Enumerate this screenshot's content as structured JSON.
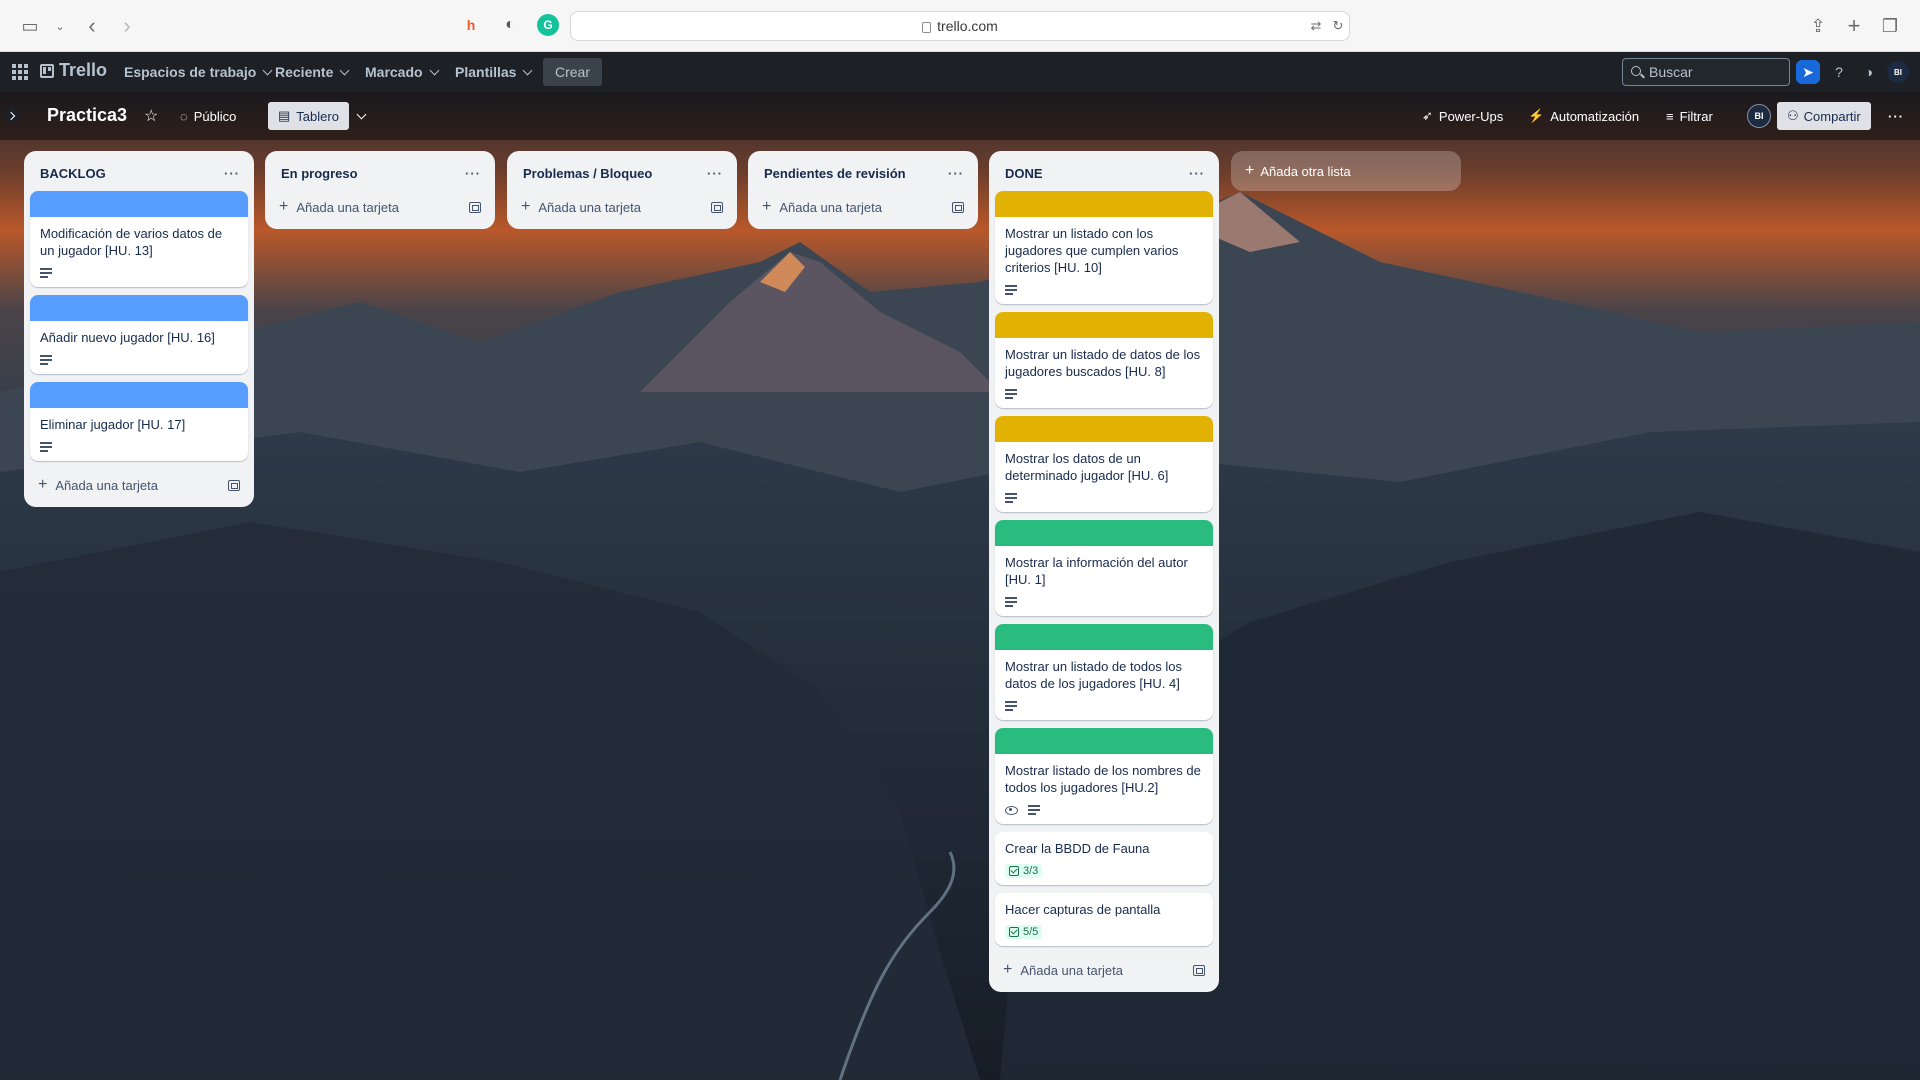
{
  "browser": {
    "url": "trello.com"
  },
  "topnav": {
    "logo": "Trello",
    "menus": [
      "Espacios de trabajo",
      "Reciente",
      "Marcado",
      "Plantillas"
    ],
    "create": "Crear",
    "search_placeholder": "Buscar",
    "avatar": "BI"
  },
  "board": {
    "title": "Practica3",
    "visibility": "Público",
    "view": "Tablero",
    "powerups": "Power-Ups",
    "automation": "Automatización",
    "filter": "Filtrar",
    "share": "Compartir",
    "avatar": "BI"
  },
  "add_card_label": "Añada una tarjeta",
  "add_list_label": "Añada otra lista",
  "lists": [
    {
      "name": "BACKLOG",
      "cards": [
        {
          "title": "Modificación de varios datos de un jugador [HU. 13]",
          "cover": "#579dff",
          "description": true
        },
        {
          "title": "Añadir nuevo jugador [HU. 16]",
          "cover": "#579dff",
          "description": true
        },
        {
          "title": "Eliminar jugador [HU. 17]",
          "cover": "#579dff",
          "description": true
        }
      ]
    },
    {
      "name": "En progreso",
      "cards": []
    },
    {
      "name": "Problemas / Bloqueo",
      "cards": []
    },
    {
      "name": "Pendientes de revisión",
      "cards": []
    },
    {
      "name": "DONE",
      "cards": [
        {
          "title": "Mostrar un listado con los jugadores que cumplen varios criterios [HU. 10]",
          "cover": "#e2b203",
          "description": true
        },
        {
          "title": "Mostrar un listado de datos de los jugadores buscados [HU. 8]",
          "cover": "#e2b203",
          "description": true
        },
        {
          "title": "Mostrar los datos de un determinado jugador [HU. 6]",
          "cover": "#e2b203",
          "description": true
        },
        {
          "title": "Mostrar la información del autor [HU. 1]",
          "cover": "#2abb7f",
          "description": true
        },
        {
          "title": "Mostrar un listado de todos los datos de los jugadores [HU. 4]",
          "cover": "#2abb7f",
          "description": true
        },
        {
          "title": "Mostrar listado de los nombres de todos los jugadores [HU.2]",
          "cover": "#2abb7f",
          "description": true,
          "watching": true
        },
        {
          "title": "Crear la BBDD de Fauna",
          "checklist": "3/3"
        },
        {
          "title": "Hacer capturas de pantalla",
          "checklist": "5/5"
        }
      ]
    }
  ],
  "colors": {
    "blue_label": "#579dff",
    "yellow_label": "#e2b203",
    "green_label": "#2abb7f"
  }
}
